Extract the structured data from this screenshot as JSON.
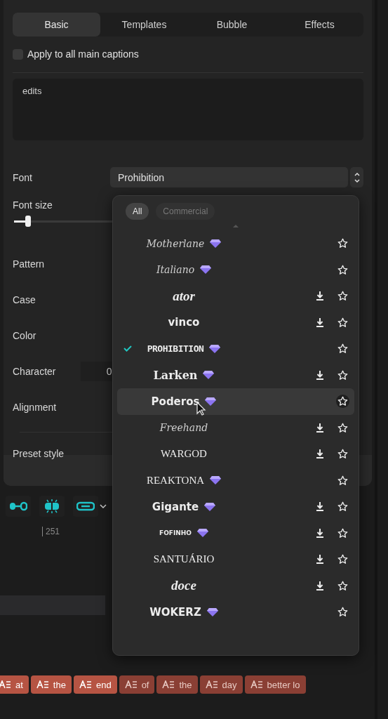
{
  "tabs": [
    {
      "label": "Basic",
      "selected": true
    },
    {
      "label": "Templates",
      "selected": false
    },
    {
      "label": "Bubble",
      "selected": false
    },
    {
      "label": "Effects",
      "selected": false
    }
  ],
  "apply_all": {
    "label": "Apply to all main captions",
    "checked": false
  },
  "text_value": "edits",
  "font": {
    "label": "Font",
    "value": "Prohibition"
  },
  "font_size": {
    "label": "Font size",
    "level": 0.02
  },
  "settings": [
    {
      "label": "Pattern"
    },
    {
      "label": "Case"
    },
    {
      "label": "Color"
    },
    {
      "label": "Character",
      "value": "0"
    },
    {
      "label": "Alignment"
    }
  ],
  "preset_label": "Preset style",
  "font_menu": {
    "filters": [
      {
        "label": "All",
        "selected": true
      },
      {
        "label": "Commercial",
        "selected": false
      }
    ],
    "fonts": [
      {
        "name": "Motherlane",
        "kind": "script",
        "premium": true,
        "download": false,
        "selected": false,
        "hovered": false
      },
      {
        "name": "Italiano",
        "kind": "script",
        "premium": true,
        "download": false,
        "selected": false,
        "hovered": false
      },
      {
        "name": "ator",
        "kind": "serif-italic",
        "premium": false,
        "download": true,
        "selected": false,
        "hovered": false
      },
      {
        "name": "vinco",
        "kind": "display",
        "premium": false,
        "download": true,
        "selected": false,
        "hovered": false
      },
      {
        "name": "PROHIBITION",
        "kind": "condensed",
        "premium": true,
        "download": false,
        "selected": true,
        "hovered": false
      },
      {
        "name": "Larken",
        "kind": "serif-bold",
        "premium": true,
        "download": true,
        "selected": false,
        "hovered": false
      },
      {
        "name": "Poderos",
        "kind": "display",
        "premium": true,
        "download": false,
        "selected": false,
        "hovered": true
      },
      {
        "name": "Freehand",
        "kind": "script",
        "premium": false,
        "download": true,
        "selected": false,
        "hovered": false
      },
      {
        "name": "WARGOD",
        "kind": "serif-caps",
        "premium": false,
        "download": true,
        "selected": false,
        "hovered": false
      },
      {
        "name": "REAKTONA",
        "kind": "serif-caps",
        "premium": true,
        "download": false,
        "selected": false,
        "hovered": false
      },
      {
        "name": "Gigante",
        "kind": "display",
        "premium": true,
        "download": true,
        "selected": false,
        "hovered": false
      },
      {
        "name": "FOFINHO",
        "kind": "tiny-bold",
        "premium": true,
        "download": true,
        "selected": false,
        "hovered": false
      },
      {
        "name": "SANTUÁRIO",
        "kind": "serif-caps",
        "premium": false,
        "download": true,
        "selected": false,
        "hovered": false
      },
      {
        "name": "doce",
        "kind": "serif-italic",
        "premium": false,
        "download": true,
        "selected": false,
        "hovered": false
      },
      {
        "name": "WOKERZ",
        "kind": "display",
        "premium": true,
        "download": false,
        "selected": false,
        "hovered": false
      }
    ]
  },
  "ruler_label": "251",
  "clips": [
    {
      "text": "at",
      "selected": true
    },
    {
      "text": "the",
      "selected": true
    },
    {
      "text": "end",
      "selected": true
    },
    {
      "text": "of",
      "selected": false
    },
    {
      "text": "the",
      "selected": false
    },
    {
      "text": "day",
      "selected": false
    },
    {
      "text": "better lo",
      "selected": false
    }
  ]
}
